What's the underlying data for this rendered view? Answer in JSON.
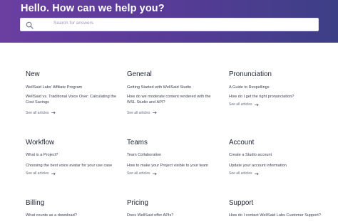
{
  "header": {
    "title": "Hello. How can we help you?",
    "search": {
      "placeholder": "Search for answers",
      "icon": "search-icon"
    }
  },
  "see_all_label": "See all articles",
  "sections": {
    "new": {
      "title": "New",
      "articles": [
        "WellSaid Labs' Affiliate Program",
        "WellSaid vs. Traditional Voice Over: Calculating the",
        "Cost Savings"
      ]
    },
    "general": {
      "title": "General",
      "articles": [
        "Getting Started with WellSaid Studio",
        "How do we moderate content rendered with the",
        "WSL Studio and API?"
      ]
    },
    "pronunciation": {
      "title": "Pronunciation",
      "articles": [
        "A Guide to Respellings",
        "How do I get the right pronunciation?"
      ]
    },
    "workflow": {
      "title": "Workflow",
      "articles": [
        "What is a Project?",
        "Choosing the best voice avatar for your use case"
      ]
    },
    "teams": {
      "title": "Teams",
      "articles": [
        "Team Collaboration",
        "How to make your Project visible to your team"
      ]
    },
    "account": {
      "title": "Account",
      "articles": [
        "Create a Studio account",
        "Update your account information"
      ]
    },
    "billing": {
      "title": "Billing",
      "articles": [
        "What counts as a download?"
      ]
    },
    "pricing": {
      "title": "Pricing",
      "articles": [
        "Does WellSaid offer APIs?"
      ]
    },
    "support": {
      "title": "Support",
      "articles": [
        "How do I contact WellSaid Labs Customer Support?"
      ]
    }
  }
}
